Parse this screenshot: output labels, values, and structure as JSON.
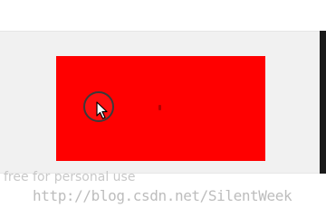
{
  "watermarks": {
    "license": "free for personal use",
    "blog_url": "http://blog.csdn.net/SilentWeek"
  },
  "colors": {
    "rectangle": "#ff0000",
    "background": "#f1f1f1",
    "cursor_ring": "#3a3a3a"
  },
  "icons": {
    "cursor": "mouse-pointer-arrow"
  }
}
